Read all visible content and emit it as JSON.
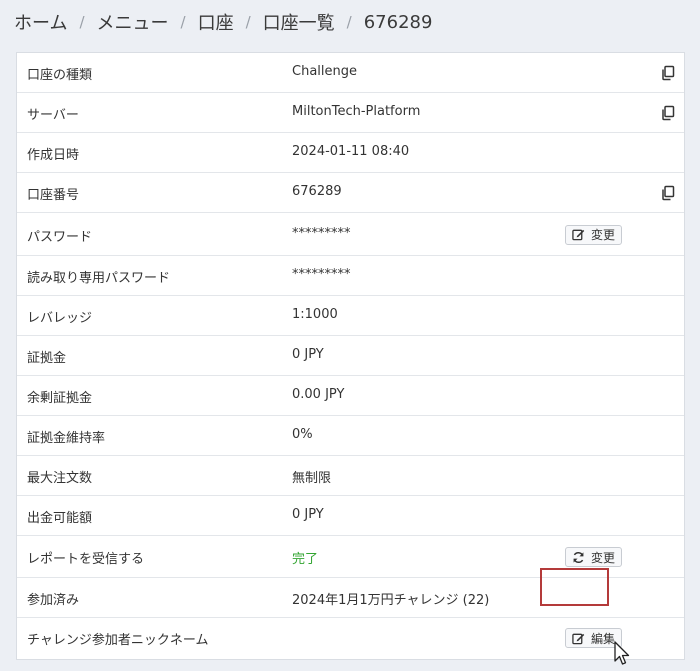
{
  "breadcrumb": {
    "items": [
      "ホーム",
      "メニュー",
      "口座",
      "口座一覧",
      "676289"
    ],
    "separator": "/"
  },
  "rows": [
    {
      "label": "口座の種類",
      "value": "Challenge",
      "icon": "copy-icon"
    },
    {
      "label": "サーバー",
      "value": "MiltonTech-Platform",
      "icon": "copy-icon"
    },
    {
      "label": "作成日時",
      "value": "2024-01-11 08:40"
    },
    {
      "label": "口座番号",
      "value": "676289",
      "icon": "copy-icon"
    },
    {
      "label": "パスワード",
      "value": "*********",
      "button": "変更",
      "button_icon": "edit-icon"
    },
    {
      "label": "読み取り専用パスワード",
      "value": "*********"
    },
    {
      "label": "レバレッジ",
      "value": "1:1000"
    },
    {
      "label": "証拠金",
      "value": "0 JPY"
    },
    {
      "label": "余剰証拠金",
      "value": "0.00 JPY"
    },
    {
      "label": "証拠金維持率",
      "value": "0%"
    },
    {
      "label": "最大注文数",
      "value": "無制限"
    },
    {
      "label": "出金可能額",
      "value": "0 JPY"
    },
    {
      "label": "レポートを受信する",
      "value": "完了",
      "value_color": "#33a532",
      "button": "変更",
      "button_icon": "refresh-icon"
    },
    {
      "label": "参加済み",
      "value": "2024年1月1万円チャレンジ (22)"
    },
    {
      "label": "チャレンジ参加者ニックネーム",
      "value": "",
      "button": "編集",
      "button_icon": "edit-icon"
    }
  ],
  "colors": {
    "background": "#eceff4",
    "success": "#33a532",
    "highlight_border": "#b43a3a"
  }
}
